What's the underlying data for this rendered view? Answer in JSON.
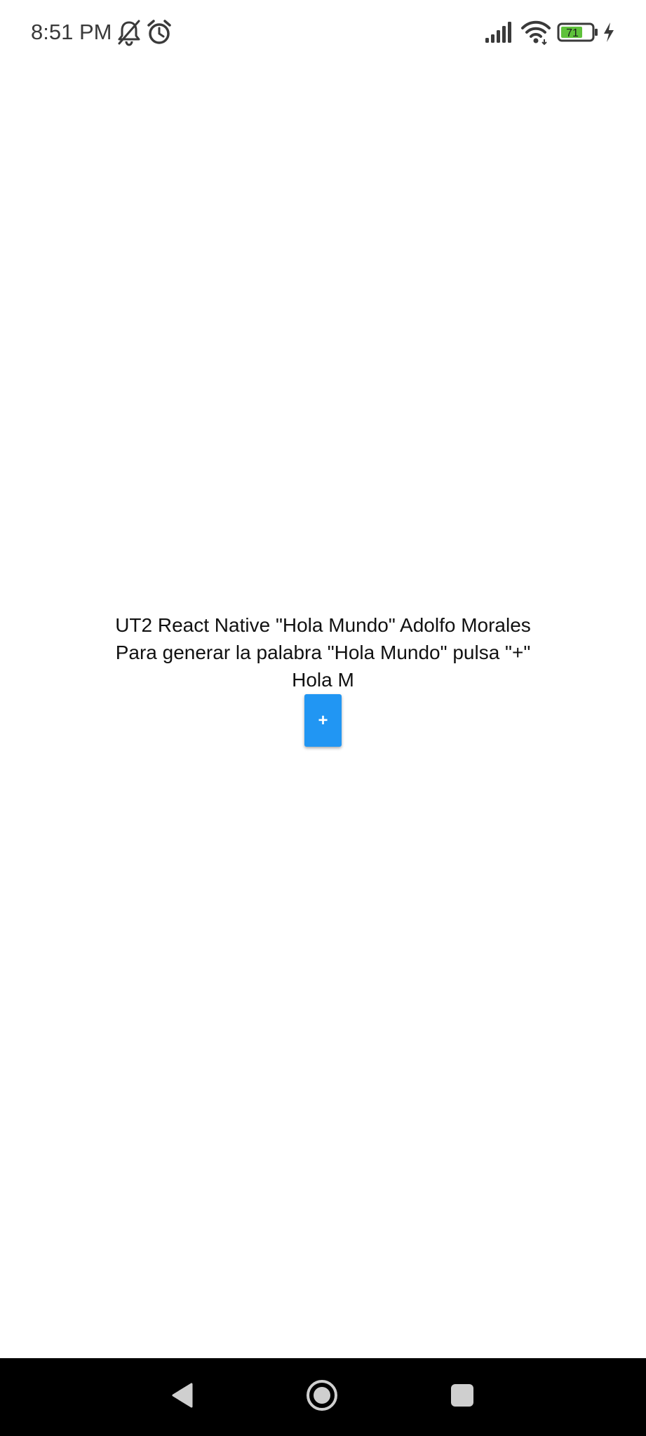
{
  "status_bar": {
    "time": "8:51 PM",
    "icons": [
      "bell-off-icon",
      "alarm-icon",
      "signal-icon",
      "wifi-icon",
      "battery-icon",
      "charging-icon"
    ],
    "battery_level": "71",
    "battery_color": "#5ec13a"
  },
  "main": {
    "title_line": "UT2 React Native \"Hola Mundo\" Adolfo Morales",
    "instruction_line": "Para generar la palabra \"Hola Mundo\" pulsa \"+\"",
    "result_text": "Hola M",
    "plus_button_label": "+",
    "accent_color": "#2196f3"
  },
  "nav_bar": {
    "buttons": [
      "back-icon",
      "home-icon",
      "recents-icon"
    ]
  }
}
